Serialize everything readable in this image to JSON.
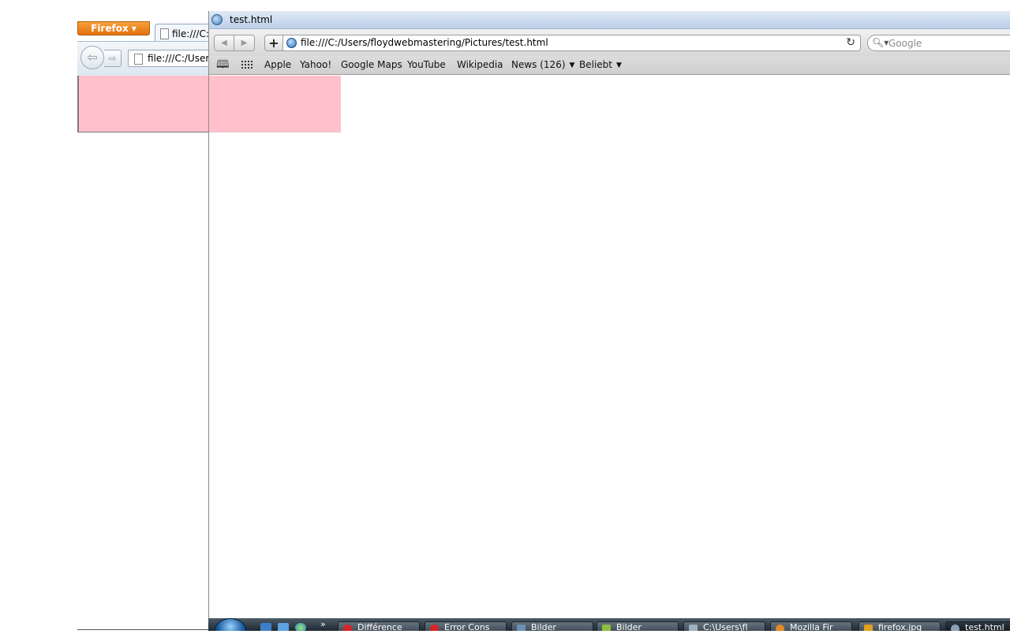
{
  "background_window": {
    "firefox_button_label": "Firefox",
    "tab_title": "file:///C:",
    "address_value": "file:///C:/Users"
  },
  "foreground_window": {
    "title": "test.html",
    "address_value": "file:///C:/Users/floydwebmastering/Pictures/test.html",
    "search_placeholder": "Google",
    "bookmarks": [
      {
        "label": "Apple"
      },
      {
        "label": "Yahoo!"
      },
      {
        "label": "Google Maps"
      },
      {
        "label": "YouTube"
      },
      {
        "label": "Wikipedia"
      },
      {
        "label": "News (126)",
        "has_dropdown": true
      },
      {
        "label": "Beliebt",
        "has_dropdown": true
      }
    ]
  },
  "taskbar": {
    "items": [
      {
        "label": "Différence"
      },
      {
        "label": "Error Cons"
      },
      {
        "label": "Bilder"
      },
      {
        "label": "Bilder"
      },
      {
        "label": "C:\\Users\\fl"
      },
      {
        "label": "Mozilla Fir"
      },
      {
        "label": "firefox.jpg"
      },
      {
        "label": "test.html"
      }
    ]
  },
  "colors": {
    "content_box": "#ffc0cb",
    "firefox_orange": "#e2700f",
    "taskbar": "#1e2a33"
  },
  "icons": [
    "page-icon",
    "back-arrow-icon",
    "forward-arrow-icon",
    "globe-icon",
    "reload-icon",
    "search-icon",
    "bookmarks-book-icon",
    "top-sites-grid-icon",
    "windows-start-orb-icon"
  ]
}
